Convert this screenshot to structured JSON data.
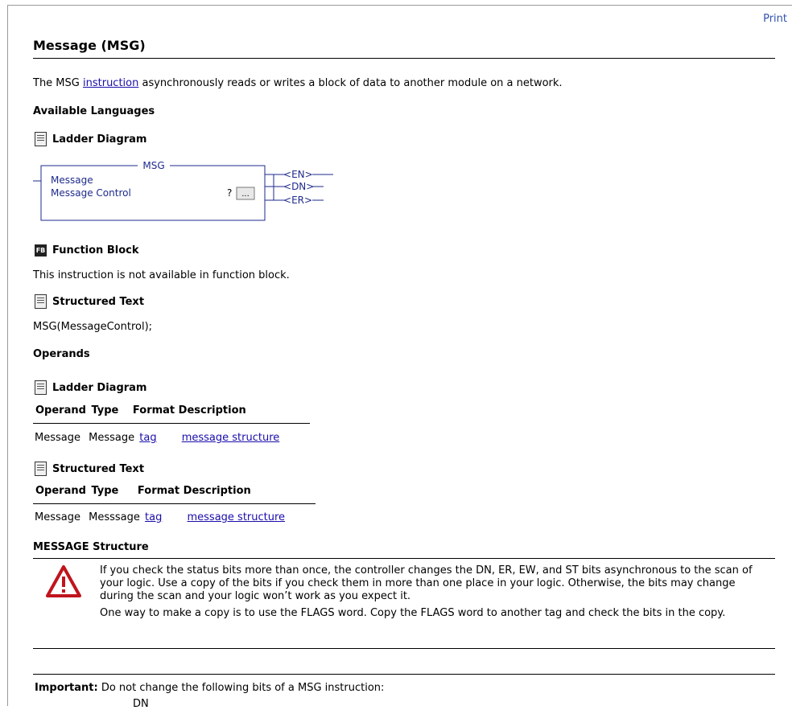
{
  "print": "Print",
  "title": "Message (MSG)",
  "intro": {
    "before": "The MSG ",
    "link": "instruction",
    "after": " asynchronously reads or writes a block of data to another module on a network."
  },
  "available_languages": "Available Languages",
  "ladder_heading": "Ladder Diagram",
  "ladder_block": {
    "name": "MSG",
    "row1": "Message",
    "row2": "Message Control",
    "value": "?",
    "button": "...",
    "outputs": [
      "EN",
      "DN",
      "ER"
    ]
  },
  "function_block": {
    "heading": "Function Block",
    "text": "This instruction is not available in function block."
  },
  "structured_text": {
    "heading": "Structured Text",
    "code": "MSG(MessageControl);"
  },
  "operands_heading": "Operands",
  "operands_ladder": {
    "heading": "Ladder Diagram",
    "col_operand": "Operand",
    "col_type": "Type",
    "col_format": "Format",
    "col_description": "Description",
    "row": {
      "operand": "Message",
      "type": "Message",
      "format": "tag",
      "description": "message structure"
    }
  },
  "operands_st": {
    "heading": "Structured Text",
    "col_operand": "Operand",
    "col_type": "Type",
    "col_format": "Format",
    "col_description": "Description",
    "row": {
      "operand": "Message",
      "type": "Messsage",
      "format": "tag",
      "description": "message structure"
    }
  },
  "message_structure": {
    "heading": "MESSAGE Structure",
    "warning_p1": "If you check the status bits more than once, the controller changes the DN, ER, EW, and ST bits asynchronous to the scan of your logic. Use a copy of the bits if you check them in more than one place in your logic. Otherwise, the bits may change during the scan and your logic won’t work as you expect it.",
    "warning_p2": "One way to make a copy is to use the FLAGS word. Copy the FLAGS word to another tag and check the bits in the copy."
  },
  "important": {
    "label": "Important:",
    "text": "Do not change the following bits of a MSG instruction:",
    "partial": "DN"
  },
  "colors": {
    "link": "#1a0dab",
    "warning_red": "#c0141c"
  },
  "icons": [
    "ladder-diagram-icon",
    "function-block-icon",
    "structured-text-icon",
    "warning-icon"
  ]
}
